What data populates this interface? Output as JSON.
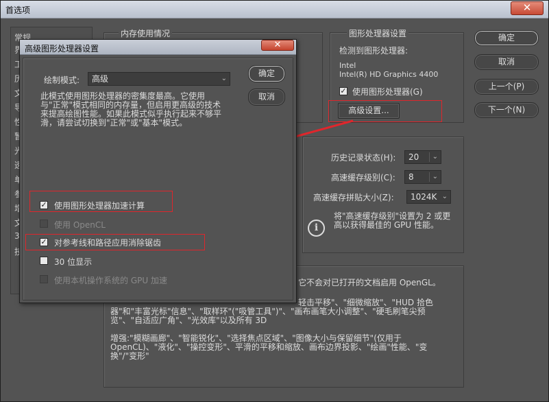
{
  "window": {
    "title": "首选项",
    "close_icon": "close-icon"
  },
  "nav": {
    "items": [
      "常规",
      "界",
      "工",
      "历",
      "文",
      "导",
      "性",
      "暂",
      "光",
      "透",
      "单",
      "参",
      "增",
      "文",
      "3D",
      "技"
    ]
  },
  "memory_group": {
    "title": "内存使用情况"
  },
  "gpu_group": {
    "title": "图形处理器设置",
    "detected_label": "检测到图形处理器:",
    "vendor": "Intel",
    "model": "Intel(R) HD Graphics 4400",
    "use_gpu_label": "使用图形处理器(G)",
    "use_gpu_checked": true,
    "advanced_button": "高级设置..."
  },
  "buttons": {
    "ok": "确定",
    "cancel": "取消",
    "prev": "上一个(P)",
    "next": "下一个(N)"
  },
  "history_cache": {
    "history_label": "历史记录状态(H):",
    "history_value": "20",
    "cache_levels_label": "高速缓存级别(C):",
    "cache_levels_value": "8",
    "tile_size_label": "高速缓存拼贴大小(Z):",
    "tile_size_value": "1024K",
    "info_text_1": "将\"高速缓存级别\"设置为 2 或更",
    "info_text_2": "高以获得最佳的 GPU 性能。",
    "info_icon": "info-icon"
  },
  "description_panel": {
    "line1": "它不会对已打开的文档启用 OpenGL。",
    "line2": "轻击平移\"、\"细微缩放\"、\"HUD 拾色",
    "line3": "器\"和\"丰富光标\"信息\"、\"取样环\"(\"吸管工具\")\"、\"画布画笔大小调整\"、\"硬毛刷笔尖预",
    "line4": "览\"、\"自适应广角\"、\"光效库\"以及所有 3D",
    "line5": "增强:\"模糊画廊\"、\"智能锐化\"、\"选择焦点区域\"、\"图像大小与保留细节\"(仅用于",
    "line6": "OpenCL)、\"液化\"、\"操控变形\"、平滑的平移和缩放、画布边界投影、\"绘画\"性能、\"变",
    "line7": "换\"/\"变形\""
  },
  "dialog": {
    "title": "高级图形处理器设置",
    "draw_mode_label": "绘制模式:",
    "draw_mode_value": "高级",
    "ok": "确定",
    "cancel": "取消",
    "desc_1": "此模式使用图形处理器的密集度最高。它使用",
    "desc_2": "与\"正常\"模式相同的内存量，但启用更高级的技术",
    "desc_3": "来提高绘图性能。如果此模式似乎执行起来不够平",
    "desc_4": "滑，请尝试切换到\"正常\"或\"基本\"模式。",
    "options": [
      {
        "label": "使用图形处理器加速计算",
        "checked": true,
        "disabled": false
      },
      {
        "label": "使用 OpenCL",
        "checked": false,
        "disabled": true
      },
      {
        "label": "对参考线和路径应用消除锯齿",
        "checked": true,
        "disabled": false
      },
      {
        "label": "30 位显示",
        "checked": false,
        "disabled": false
      },
      {
        "label": "使用本机操作系统的 GPU 加速",
        "checked": false,
        "disabled": true
      }
    ]
  },
  "colors": {
    "highlight_red": "#e0262c",
    "background": "#535353"
  }
}
